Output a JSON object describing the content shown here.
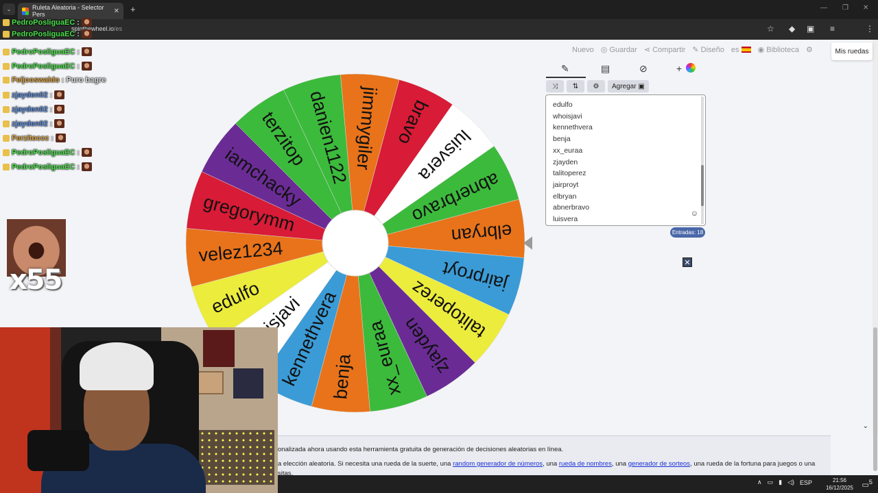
{
  "browser": {
    "tab_title": "Ruleta Aleatoria - Selector Pers",
    "tab_close": "✕",
    "new_tab": "+",
    "url_host": "spinthewheel.io",
    "url_path": "/es",
    "tab_menu": "⌄",
    "win_min": "—",
    "win_max": "❐",
    "win_close": "✕"
  },
  "nav": {
    "nuevo": "Nuevo",
    "guardar": "Guardar",
    "compartir": "Compartir",
    "diseno": "Diseño",
    "lang": "es",
    "biblioteca": "Biblioteca",
    "mis_ruedas": "Mis ruedas"
  },
  "toolbar": {
    "agregar": "Agregar",
    "shuffle_icon": "⤨",
    "sort_icon": "⇅",
    "settings_icon": "⚙",
    "plus": "+"
  },
  "entries": [
    "edulfo",
    "whoisjavi",
    "kennethvera",
    "benja",
    "xx_euraa",
    "zjayden",
    "talitoperez",
    "jairproyt",
    "elbryan",
    "abnerbravo",
    "luisvera"
  ],
  "entries_count": "Entradas: 18",
  "wheel": {
    "segments": [
      {
        "label": "bravo",
        "color": "#d81b36"
      },
      {
        "label": "luisvera",
        "color": "#ffffff"
      },
      {
        "label": "abnerbravo",
        "color": "#3cba3c"
      },
      {
        "label": "elbryan",
        "color": "#e8731a"
      },
      {
        "label": "jairproyt",
        "color": "#3b9bd6"
      },
      {
        "label": "talitoperez",
        "color": "#ecec3c"
      },
      {
        "label": "zjayden",
        "color": "#6a2c94"
      },
      {
        "label": "xx_euraa",
        "color": "#3cba3c"
      },
      {
        "label": "benja",
        "color": "#e8731a"
      },
      {
        "label": "kennethvera",
        "color": "#3b9bd6"
      },
      {
        "label": "whoisjavi",
        "color": "#ffffff"
      },
      {
        "label": "edulfo",
        "color": "#ecec3c"
      },
      {
        "label": "velez1234",
        "color": "#e8731a"
      },
      {
        "label": "gregorymm",
        "color": "#d81b36"
      },
      {
        "label": "iamchacky",
        "color": "#6a2c94"
      },
      {
        "label": "terzitop",
        "color": "#3cba3c"
      },
      {
        "label": "danien1122",
        "color": "#3cba3c"
      },
      {
        "label": "jimmygiler",
        "color": "#e8731a"
      }
    ]
  },
  "chat": [
    {
      "user": "PedroPosliguaEC",
      "color": "#4ae04a",
      "msg": ":"
    },
    {
      "user": "PedroPosliguaEC",
      "color": "#4ae04a",
      "msg": ":"
    },
    {
      "user": "PedroPosliguaEC",
      "color": "#4ae04a",
      "msg": ":"
    },
    {
      "user": "PedroPosliguaEC",
      "color": "#4ae04a",
      "msg": ":"
    },
    {
      "user": "Feijooswaldo",
      "color": "#d8a040",
      "msg": ": Puro bagre"
    },
    {
      "user": "zjayden02",
      "color": "#5a8ad8",
      "msg": ":"
    },
    {
      "user": "zjayden02",
      "color": "#5a8ad8",
      "msg": ":"
    },
    {
      "user": "zjayden02",
      "color": "#5a8ad8",
      "msg": ":"
    },
    {
      "user": "Ferzitoccc",
      "color": "#d8a040",
      "msg": ":"
    },
    {
      "user": "PedroPosliguaEC",
      "color": "#4ae04a",
      "msg": ":"
    },
    {
      "user": "PedroPosliguaEC",
      "color": "#4ae04a",
      "msg": ":"
    }
  ],
  "overlay": {
    "multiplier": "x55"
  },
  "footer": {
    "line1": "onalizada ahora usando esta herramienta gratuita de generación de decisiones aleatorias en línea.",
    "line2_pre": "a elección aleatoria. Si necesita una rueda de la suerte, una ",
    "link1": "random generador de números",
    "line2_mid1": ", una ",
    "link2": "rueda de nombres",
    "line2_mid2": ", una ",
    "link3": "generador de sorteos",
    "line2_post": ", una rueda de la fortuna para juegos o una",
    "line3": "sitas."
  },
  "taskbar": {
    "lang": "ESP",
    "time": "21:56",
    "date": "16/12/2025",
    "notif_count": "5"
  }
}
